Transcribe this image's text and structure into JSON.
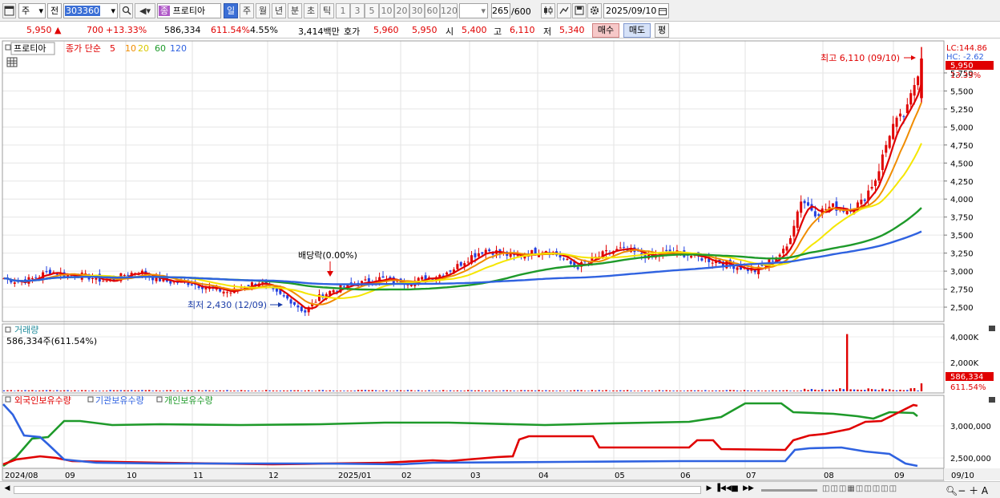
{
  "toolbar": {
    "type_select": "주",
    "prev_select": "전",
    "code": "303360",
    "stock_tag": "종",
    "stock_name": "프로티아",
    "periods": [
      "일",
      "주",
      "월",
      "년",
      "분",
      "초",
      "틱"
    ],
    "intervals": [
      "1",
      "3",
      "5",
      "10",
      "20",
      "30",
      "60",
      "120"
    ],
    "count": "265",
    "count_total": "/600",
    "date": "2025/09/10"
  },
  "quote": {
    "price": "5,950",
    "change": "700",
    "change_pct": "+13.33%",
    "volume": "586,334",
    "volume_ratio": "611.54%",
    "turnover": "4.55%",
    "amount": "3,414백만",
    "bid_label": "호가",
    "ask": "5,960",
    "bid": "5,950",
    "open_label": "시",
    "open": "5,400",
    "high_label": "고",
    "high": "6,110",
    "low_label": "저",
    "low": "5,340",
    "buy_btn": "매수",
    "sell_btn": "매도",
    "eval_btn": "평"
  },
  "price_panel": {
    "name_box": "프로티아",
    "ma_title": "종가 단순",
    "ma_labels": [
      "5",
      "10",
      "20",
      "60",
      "120"
    ],
    "high_annot": "최고 6,110 (09/10)",
    "low_annot": "최저 2,430 (12/09)",
    "dividend_annot": "배당락(0.00%)",
    "lc": "LC:144.86",
    "hc": "HC: -2.62",
    "cur_price_tag": "5,950",
    "cur_pct_tag": "13.33%",
    "y_ticks": [
      "5,750",
      "5,500",
      "5,250",
      "5,000",
      "4,750",
      "4,500",
      "4,250",
      "4,000",
      "3,750",
      "3,500",
      "3,250",
      "3,000",
      "2,750",
      "2,500"
    ]
  },
  "volume_panel": {
    "title": "거래량",
    "sub": "586,334주(611.54%)",
    "y_ticks": [
      "4,000K",
      "2,000K"
    ],
    "tag_val": "586,334",
    "tag_pct": "611.54%"
  },
  "holdings_panel": {
    "legend": [
      "외국인보유수량",
      "기관보유수량",
      "개인보유수량"
    ],
    "y_ticks": [
      "3,000,000",
      "2,500,000"
    ]
  },
  "x_axis": [
    "2024/08",
    "09",
    "10",
    "11",
    "12",
    "2025/01",
    "02",
    "03",
    "04",
    "05",
    "06",
    "07",
    "08",
    "09",
    "09/10"
  ],
  "colors": {
    "ma5": "#e00000",
    "ma10": "#f08c00",
    "ma20": "#f5e600",
    "ma60": "#1e9a2a",
    "ma120": "#2f62e0",
    "up": "#e00000",
    "down": "#2440e0"
  },
  "chart_data": {
    "type": "line",
    "title": "",
    "price_range": [
      2300,
      6150
    ],
    "price_series_close": [
      2900,
      2850,
      2900,
      3000,
      2950,
      2950,
      2900,
      2850,
      2950,
      3000,
      2900,
      2850,
      2850,
      2800,
      2750,
      2700,
      2800,
      2850,
      2700,
      2600,
      2430,
      2650,
      2750,
      2800,
      2850,
      2900,
      2850,
      2850,
      2900,
      2950,
      3050,
      3200,
      3300,
      3250,
      3200,
      3250,
      3300,
      3200,
      3050,
      3150,
      3250,
      3300,
      3250,
      3200,
      3250,
      3250,
      3200,
      3150,
      3100,
      3050,
      3000,
      3150,
      3300,
      4000,
      3800,
      3900,
      3850,
      3950,
      4300,
      5000,
      5200,
      5950
    ],
    "volume_peak_k": 4200,
    "holding_series": [
      {
        "name": "외국인보유수량",
        "color": "#e00000"
      },
      {
        "name": "기관보유수량",
        "color": "#2f62e0"
      },
      {
        "name": "개인보유수량",
        "color": "#1e9a2a"
      }
    ]
  }
}
